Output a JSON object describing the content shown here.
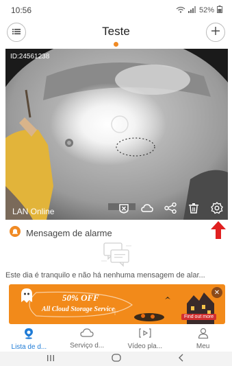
{
  "status": {
    "time": "10:56",
    "battery": "52%"
  },
  "header": {
    "title": "Teste"
  },
  "video": {
    "device_id": "ID:24561238",
    "connection": "LAN Online"
  },
  "alarm": {
    "label": "Mensagem de alarme"
  },
  "empty": {
    "message": "Este dia é tranquilo e não há nenhuma mensagem de alar..."
  },
  "banner": {
    "discount": "50% OFF",
    "service": "All Cloud Storage Service",
    "cta": "Find out more"
  },
  "tabs": [
    {
      "label": "Lista de d...",
      "icon": "location-pin-icon",
      "active": true
    },
    {
      "label": "Serviço d...",
      "icon": "cloud-icon",
      "active": false
    },
    {
      "label": "Vídeo pla...",
      "icon": "video-play-icon",
      "active": false
    },
    {
      "label": "Meu",
      "icon": "person-icon",
      "active": false
    }
  ],
  "colors": {
    "accent": "#1e7bd6",
    "orange": "#f08a24",
    "banner": "#f28a1a",
    "arrow": "#e02020"
  }
}
